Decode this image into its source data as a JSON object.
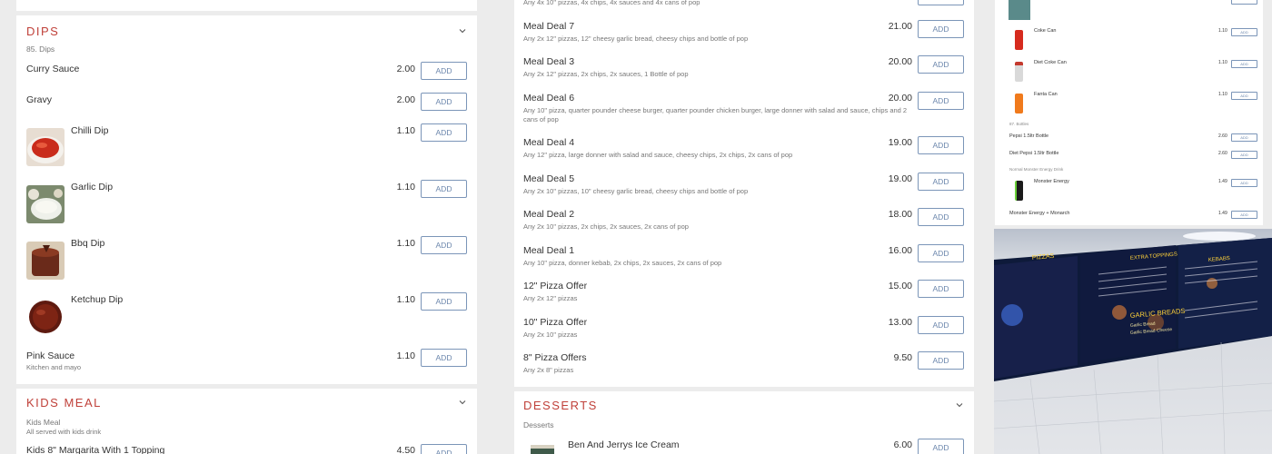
{
  "left": {
    "dips": {
      "title": "DIPS",
      "subtitle": "85. Dips",
      "items": [
        {
          "name": "Curry Sauce",
          "desc": "",
          "price": "2.00",
          "add": "ADD"
        },
        {
          "name": "Gravy",
          "desc": "",
          "price": "2.00",
          "add": "ADD"
        },
        {
          "name": "Chilli Dip",
          "desc": "",
          "price": "1.10",
          "add": "ADD"
        },
        {
          "name": "Garlic Dip",
          "desc": "",
          "price": "1.10",
          "add": "ADD"
        },
        {
          "name": "Bbq Dip",
          "desc": "",
          "price": "1.10",
          "add": "ADD"
        },
        {
          "name": "Ketchup Dip",
          "desc": "",
          "price": "1.10",
          "add": "ADD"
        },
        {
          "name": "Pink Sauce",
          "desc": "Kitchen and mayo",
          "price": "1.10",
          "add": "ADD"
        }
      ]
    },
    "kids": {
      "title": "KIDS MEAL",
      "subtitle": "Kids Meal",
      "subtitle2": "All served with kids drink",
      "first_item": {
        "name": "Kids 8\" Margarita With 1 Topping",
        "price": "4.50",
        "add": "ADD"
      }
    }
  },
  "middle": {
    "top_desc": "Any 4x 10\" pizzas, 4x chips, 4x sauces and 4x cans of pop",
    "deals": [
      {
        "name": "Meal Deal 7",
        "desc": "Any 2x 12\" pizzas, 12\" cheesy garlic bread, cheesy chips and bottle of pop",
        "price": "21.00",
        "add": "ADD"
      },
      {
        "name": "Meal Deal 3",
        "desc": "Any 2x 12\" pizzas, 2x chips, 2x sauces, 1 Bottle of pop",
        "price": "20.00",
        "add": "ADD"
      },
      {
        "name": "Meal Deal 6",
        "desc": "Any 10\" pizza, quarter pounder cheese burger, quarter pounder chicken burger, large donner with salad and sauce, chips and 2 cans of pop",
        "price": "20.00",
        "add": "ADD"
      },
      {
        "name": "Meal Deal 4",
        "desc": "Any 12\" pizza, large donner with salad and sauce, cheesy chips, 2x chips, 2x cans of pop",
        "price": "19.00",
        "add": "ADD"
      },
      {
        "name": "Meal Deal 5",
        "desc": "Any 2x 10\" pizzas, 10\" cheesy garlic bread, cheesy chips and bottle of pop",
        "price": "19.00",
        "add": "ADD"
      },
      {
        "name": "Meal Deal 2",
        "desc": "Any 2x 10\" pizzas, 2x chips, 2x sauces, 2x cans of pop",
        "price": "18.00",
        "add": "ADD"
      },
      {
        "name": "Meal Deal 1",
        "desc": "Any 10\" pizza, donner kebab, 2x chips, 2x sauces, 2x cans of pop",
        "price": "16.00",
        "add": "ADD"
      },
      {
        "name": "12\" Pizza Offer",
        "desc": "Any 2x 12\" pizzas",
        "price": "15.00",
        "add": "ADD"
      },
      {
        "name": "10\" Pizza Offer",
        "desc": "Any 2x 10\" pizzas",
        "price": "13.00",
        "add": "ADD"
      },
      {
        "name": "8\" Pizza Offers",
        "desc": "Any 2x 8\" pizzas",
        "price": "9.50",
        "add": "ADD"
      }
    ],
    "desserts": {
      "title": "DESSERTS",
      "subtitle": "Desserts",
      "first_item": {
        "name": "Ben And Jerrys Ice Cream",
        "price": "6.00",
        "add": "ADD"
      }
    }
  },
  "mini_menu": {
    "items": [
      {
        "name": "Coke Can",
        "price": "1.10",
        "add": "ADD"
      },
      {
        "name": "Diet Coke Can",
        "price": "1.10",
        "add": "ADD"
      },
      {
        "name": "Fanta Can",
        "price": "1.10",
        "add": "ADD"
      }
    ],
    "bottles_label": "87. Bottles",
    "bottles": [
      {
        "name": "Pepsi 1.5ltr Bottle",
        "price": "2.60",
        "add": "ADD"
      },
      {
        "name": "Diet Pepsi 1.5ltr Bottle",
        "price": "2.60",
        "add": "ADD"
      }
    ],
    "energy_label": "Normal Monster Energy Drink",
    "energy": [
      {
        "name": "Monster Energy",
        "price": "1.49",
        "add": "ADD"
      },
      {
        "name": "Monster Energy + Monarch",
        "price": "1.49",
        "add": "ADD"
      }
    ]
  },
  "photo": {
    "sign_words": [
      "PIZZAS",
      "EXTRA TOPPINGS",
      "KEBABS",
      "GARLIC BREADS",
      "Garlic Bread",
      "Garlic Bread Cheese"
    ]
  },
  "colors": {
    "accent": "#c0413a",
    "button_border": "#7b95b8",
    "button_text": "#6b86ac",
    "background": "#ececec"
  }
}
